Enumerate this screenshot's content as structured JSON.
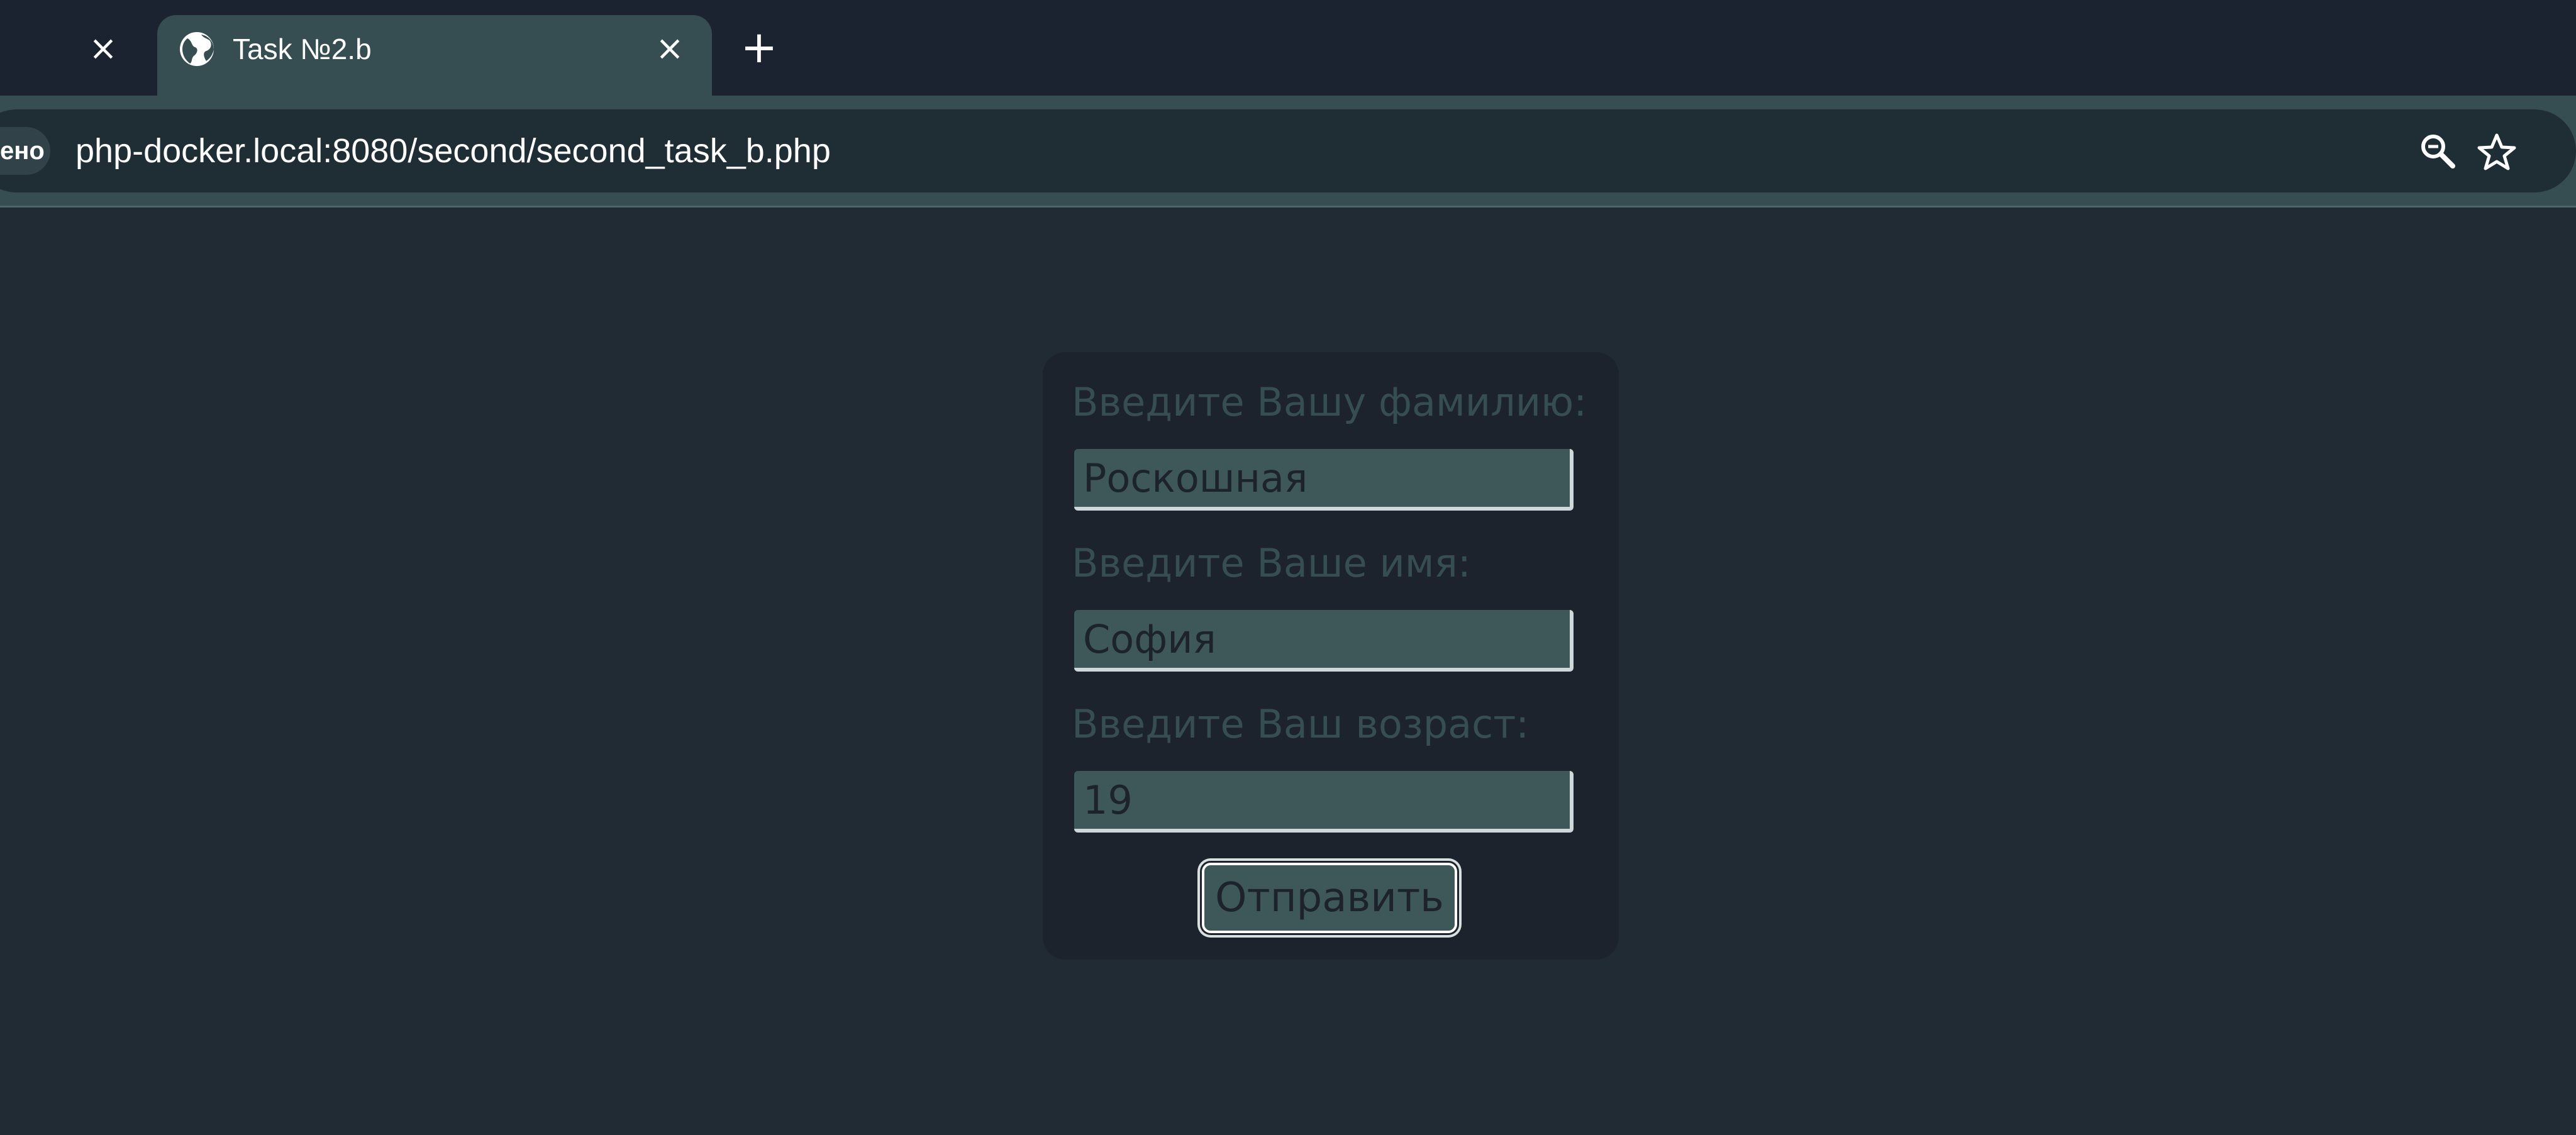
{
  "browser": {
    "previous_tab_close": "×",
    "active_tab": {
      "title": "Task №2.b",
      "icon": "globe-icon",
      "close": "×"
    },
    "new_tab": "+",
    "security_chip": "ено",
    "url": "php-docker.local:8080/second/second_task_b.php",
    "toolbar_icons": [
      "zoom-icon",
      "star-icon"
    ]
  },
  "form": {
    "surname": {
      "label": "Введите Вашу фамилию:",
      "value": "Роскошная"
    },
    "name": {
      "label": "Введите Ваше имя:",
      "value": "София"
    },
    "age": {
      "label": "Введите Ваш возраст:",
      "value": "19"
    },
    "submit_label": "Отправить"
  },
  "colors": {
    "page_background": "#202b34",
    "card_background": "#1c232d",
    "input_background": "#3e5859",
    "label_text": "#364d52",
    "tab_active": "#364d52",
    "tabstrip": "#1c2330"
  }
}
